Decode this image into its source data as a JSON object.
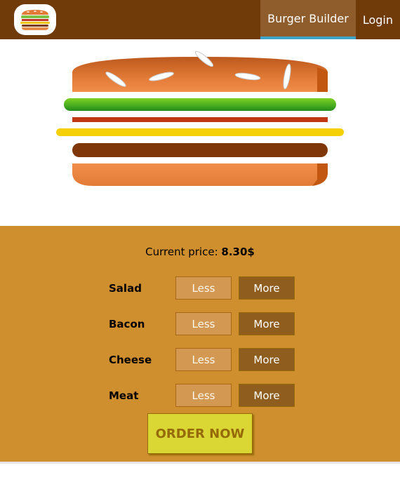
{
  "toolbar": {
    "logo_icon": "burger-logo-icon",
    "nav": [
      {
        "label": "Burger Builder",
        "active": true
      },
      {
        "label": "Login",
        "active": false
      }
    ]
  },
  "burger": {
    "layers": [
      "bread-top",
      "salad",
      "bacon",
      "cheese",
      "meat",
      "bread-bottom"
    ]
  },
  "build_controls": {
    "price_label": "Current price:",
    "price_value": "8.30$",
    "less_label": "Less",
    "more_label": "More",
    "ingredients": [
      {
        "label": "Salad"
      },
      {
        "label": "Bacon"
      },
      {
        "label": "Cheese"
      },
      {
        "label": "Meat"
      }
    ],
    "order_label": "ORDER NOW"
  },
  "colors": {
    "toolbar": "#703b09",
    "controls_bg": "#cf8f2e",
    "more_button": "#8f5e1e",
    "less_button": "#d39952",
    "order_button": "#dad735",
    "active_nav_underline": "#40a4c8"
  }
}
